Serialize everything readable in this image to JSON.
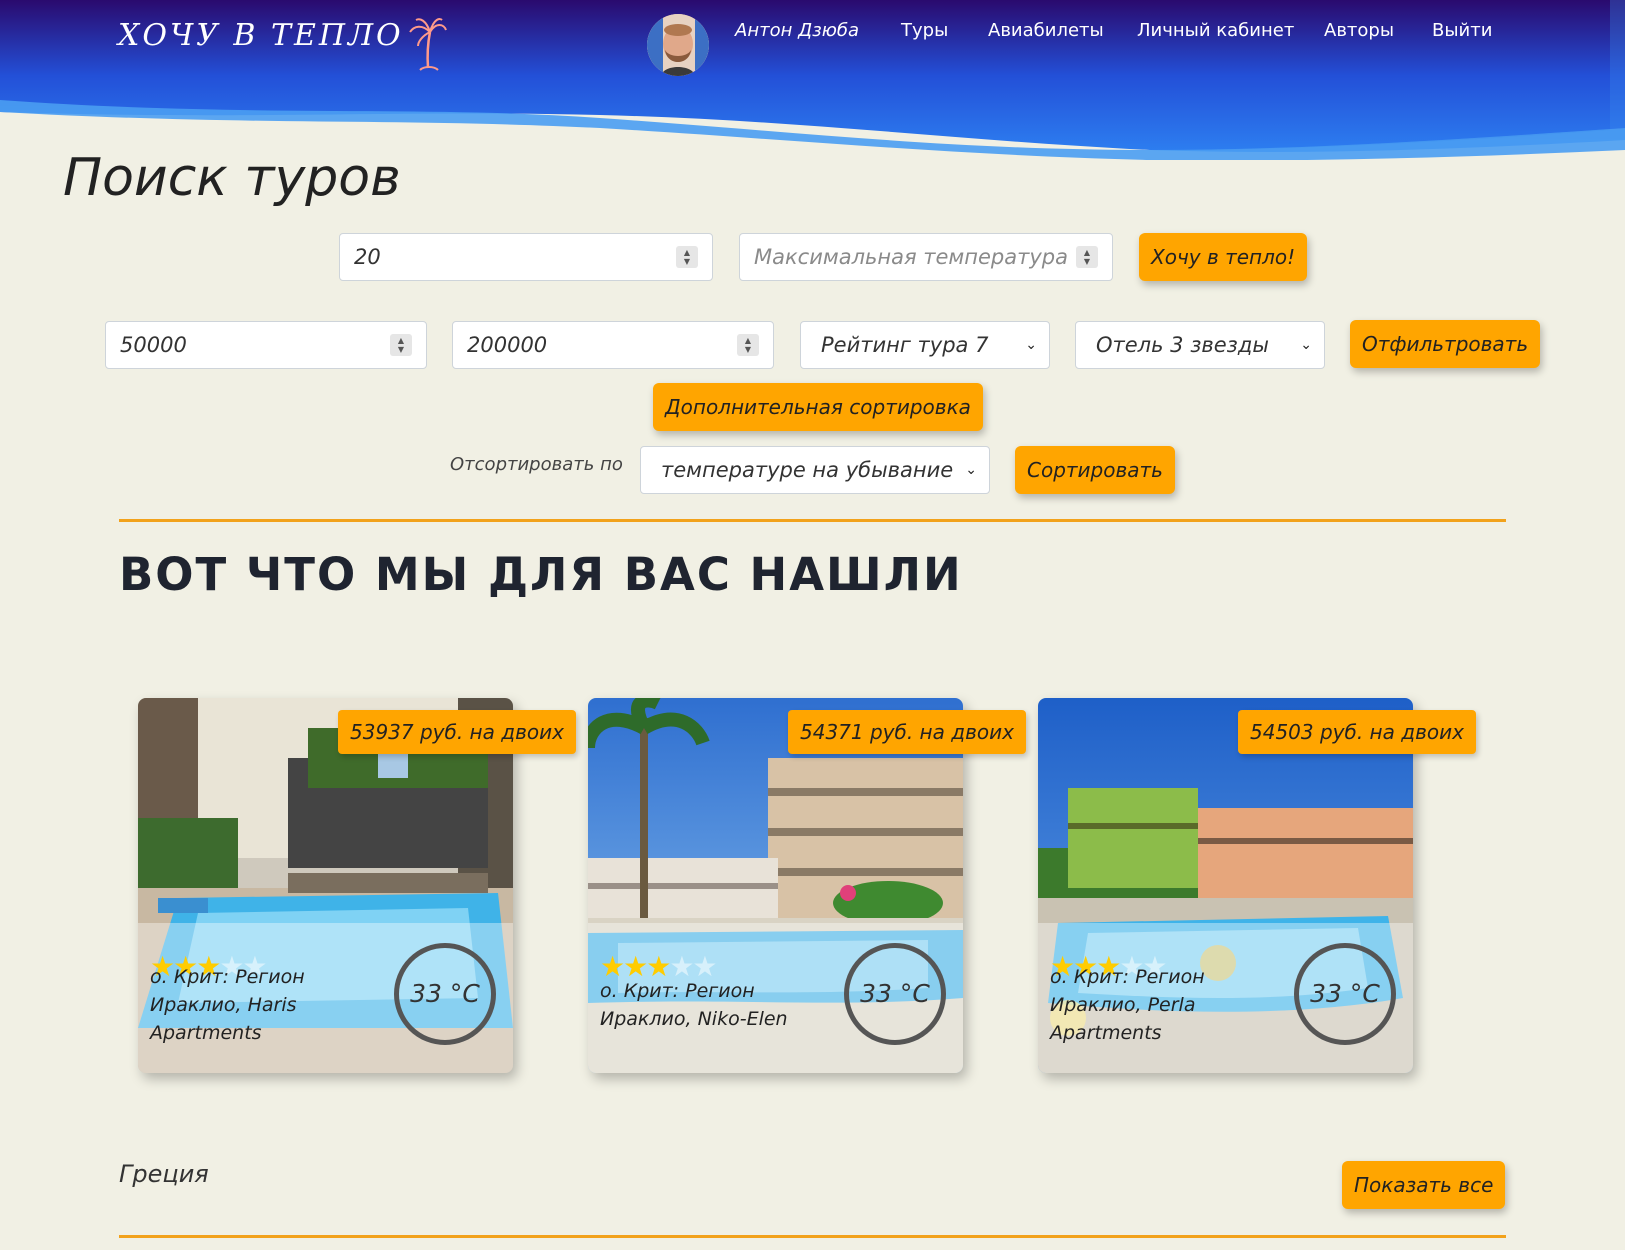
{
  "header": {
    "brand": "ХОЧУ В ТЕПЛО",
    "user_name": "Антон Дзюба",
    "nav": [
      "Туры",
      "Авиабилеты",
      "Личный кабинет",
      "Авторы",
      "Выйти"
    ]
  },
  "page_title": "Поиск туров",
  "search": {
    "min_temp_value": "20",
    "max_temp_placeholder": "Максимальная температура",
    "warm_button": "Хочу в тепло!"
  },
  "filters": {
    "price_min": "50000",
    "price_max": "200000",
    "rating_selected": "Рейтинг тура 7",
    "hotel_selected": "Отель 3 звезды",
    "filter_button": "Отфильтровать",
    "extra_sort_button": "Дополнительная сортировка"
  },
  "sort": {
    "label": "Отсортировать по",
    "selected": "температуре на убывание",
    "button": "Сортировать"
  },
  "results_title": "ВОТ ЧТО МЫ ДЛЯ ВАС НАШЛИ",
  "cards": [
    {
      "price": "53937 руб. на двоих",
      "stars": 3,
      "hotel": "о. Крит: Регион Ираклио, Haris Apartments",
      "temp": "33 °C"
    },
    {
      "price": "54371 руб. на двоих",
      "stars": 3,
      "hotel": "о. Крит: Регион Ираклио, Niko-Elen",
      "temp": "33 °C"
    },
    {
      "price": "54503 руб. на двоих",
      "stars": 3,
      "hotel": "о. Крит: Регион Ираклио, Perla Apartments",
      "temp": "33 °C"
    }
  ],
  "country": {
    "name": "Греция",
    "show_all": "Показать все"
  },
  "icons": {
    "palm": "palm-tree-icon",
    "star": "star-icon",
    "chevron": "chevron-down-icon",
    "spinner": "number-spinner-icon"
  },
  "colors": {
    "accent": "#ffa500",
    "header_dark": "#2a0a6e",
    "header_blue": "#2d73e6",
    "background": "#f1f0e4",
    "star": "#ffcc00"
  }
}
